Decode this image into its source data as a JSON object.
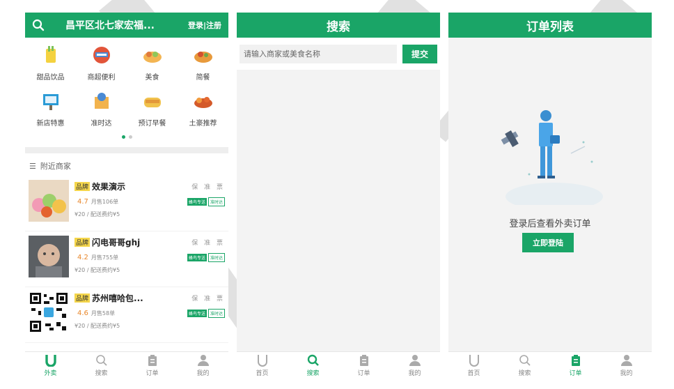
{
  "colors": {
    "brand": "#1aa567",
    "rating": "#e8862a",
    "badge": "#f5d64b"
  },
  "home": {
    "address": "昌平区北七家宏福...",
    "login": "登录|注册",
    "categories": [
      {
        "label": "甜品饮品",
        "icon": "drink-icon"
      },
      {
        "label": "商超便利",
        "icon": "supermarket-icon"
      },
      {
        "label": "美食",
        "icon": "food-icon"
      },
      {
        "label": "简餐",
        "icon": "meal-icon"
      },
      {
        "label": "新店特惠",
        "icon": "new-store-icon"
      },
      {
        "label": "准时达",
        "icon": "ontime-icon"
      },
      {
        "label": "预订早餐",
        "icon": "breakfast-icon"
      },
      {
        "label": "土豪推荐",
        "icon": "recommend-icon"
      }
    ],
    "nearby_title": "附近商家",
    "shops": [
      {
        "badge": "品牌",
        "name": "效果演示",
        "tags": "保 准 票",
        "rating": "4.7",
        "sold": "月售106单",
        "pill1": "蜂鸟专送",
        "pill2": "准时达",
        "price": "¥20 / 配送费约¥5"
      },
      {
        "badge": "品牌",
        "name": "闪电哥哥ghj",
        "tags": "保 准 票",
        "rating": "4.2",
        "sold": "月售755单",
        "pill1": "蜂鸟专送",
        "pill2": "准时达",
        "price": "¥20 / 配送费约¥5"
      },
      {
        "badge": "品牌",
        "name": "苏州嘻哈包...",
        "tags": "保 准 票",
        "rating": "4.6",
        "sold": "月售58单",
        "pill1": "蜂鸟专送",
        "pill2": "准时达",
        "price": "¥20 / 配送费约¥5"
      }
    ],
    "tabs": [
      "外卖",
      "搜索",
      "订单",
      "我的"
    ]
  },
  "search": {
    "title": "搜索",
    "placeholder": "请输入商家或美食名称",
    "submit": "提交",
    "tabs": [
      "首页",
      "搜索",
      "订单",
      "我的"
    ]
  },
  "orders": {
    "title": "订单列表",
    "message": "登录后查看外卖订单",
    "button": "立即登陆",
    "tabs": [
      "首页",
      "搜索",
      "订单",
      "我的"
    ]
  }
}
